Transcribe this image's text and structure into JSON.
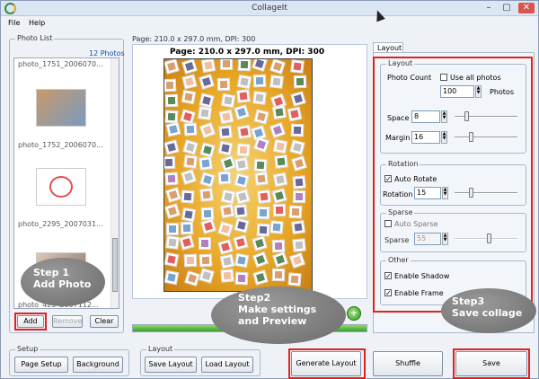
{
  "window": {
    "title": "CollageIt",
    "minimize": "–",
    "maximize": "▢",
    "close": "✕"
  },
  "menu": {
    "file": "File",
    "help": "Help"
  },
  "photo_list": {
    "title": "Photo List",
    "count": "12 Photos",
    "items": [
      {
        "name": "photo_1751_2006070..."
      },
      {
        "name": "photo_1752_2006070..."
      },
      {
        "name": "photo_2295_2007031..."
      },
      {
        "name": "photo_425_2007112..."
      }
    ],
    "add": "Add",
    "remove": "Remove",
    "clear": "Clear"
  },
  "page": {
    "info": "Page: 210.0 x 297.0 mm, DPI: 300",
    "header": "Page: 210.0 x 297.0 mm, DPI: 300"
  },
  "layout_panel": {
    "tab": "Layout",
    "layout_group": "Layout",
    "photo_count_label": "Photo Count",
    "use_all": "Use all photos",
    "photo_count_value": "100",
    "photos_unit": "Photos",
    "space_label": "Space",
    "space_value": "8",
    "margin_label": "Margin",
    "margin_value": "16",
    "rotation_group": "Rotation",
    "auto_rotate": "Auto Rotate",
    "rotation_label": "Rotation",
    "rotation_value": "15",
    "sparse_group": "Sparse",
    "auto_sparse": "Auto Sparse",
    "sparse_label": "Sparse",
    "sparse_value": "55",
    "other_group": "Other",
    "enable_shadow": "Enable Shadow",
    "enable_frame": "Enable Frame",
    "check_mark": "✓"
  },
  "setup": {
    "title": "Setup",
    "page_setup": "Page Setup",
    "background": "Background"
  },
  "layout_bottom": {
    "title": "Layout",
    "save_layout": "Save Layout",
    "load_layout": "Load Layout"
  },
  "actions": {
    "generate": "Generate Layout",
    "shuffle": "Shuffle",
    "save": "Save"
  },
  "callouts": {
    "step1": [
      "Step 1",
      "Add Photo"
    ],
    "step2": [
      "Step2",
      "Make settings",
      "and Preview"
    ],
    "step3": [
      "Step3",
      "Save collage"
    ]
  },
  "colors": {
    "highlight": "#e0221f",
    "callout": "#7a7a7a",
    "canvas": "#e8a524",
    "progress": "#4caf3c"
  }
}
